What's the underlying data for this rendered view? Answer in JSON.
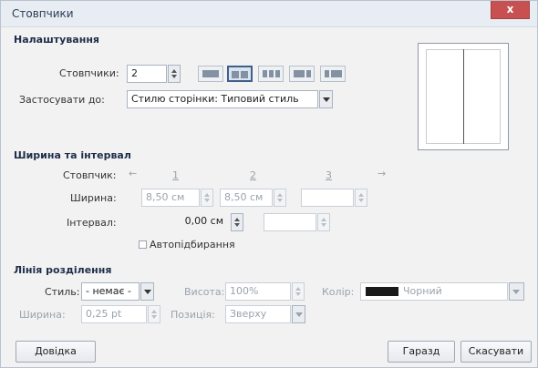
{
  "window": {
    "title": "Стовпчики",
    "close_glyph": "x"
  },
  "settings": {
    "heading": "Налаштування",
    "columns_label": "Стовпчики:",
    "columns_value": "2",
    "apply_to_label": "Застосувати до:",
    "apply_to_value": "Стилю сторінки: Типовий стиль",
    "presets": [
      "1 column",
      "2 columns",
      "3 columns",
      "2 columns left-weighted",
      "2 columns right-weighted"
    ],
    "selected_preset": 1
  },
  "width_spacing": {
    "heading": "Ширина та інтервал",
    "column_label": "Стовпчик:",
    "column_numbers": [
      "1",
      "2",
      "3"
    ],
    "width_label": "Ширина:",
    "width_values": [
      "8,50 см",
      "8,50 см",
      ""
    ],
    "spacing_label": "Інтервал:",
    "spacing_values": [
      "0,00 см",
      ""
    ],
    "autofit_label": "Автопідбирання",
    "autofit_checked": false
  },
  "separator": {
    "heading": "Лінія розділення",
    "style_label": "Стиль:",
    "style_value": "- немає -",
    "height_label": "Висота:",
    "height_value": "100%",
    "color_label": "Колір:",
    "color_value": "Чорний",
    "color_hex": "#1a1a1a",
    "width_label": "Ширина:",
    "width_value": "0,25 pt",
    "position_label": "Позиція:",
    "position_value": "Зверху"
  },
  "buttons": {
    "help": "Довідка",
    "ok": "Гаразд",
    "cancel": "Скасувати"
  }
}
